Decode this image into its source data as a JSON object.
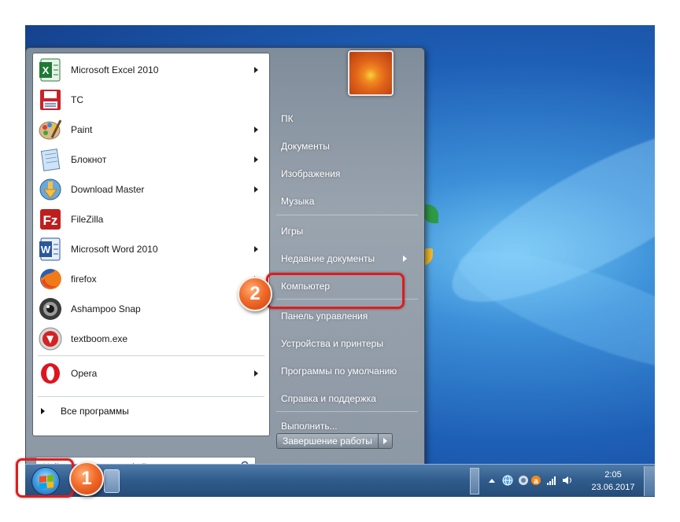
{
  "programs": [
    {
      "label": "Microsoft Excel 2010",
      "icon": "excel-icon",
      "submenu": true
    },
    {
      "label": "TC",
      "icon": "total-commander-icon",
      "submenu": false
    },
    {
      "label": "Paint",
      "icon": "paint-icon",
      "submenu": true
    },
    {
      "label": "Блокнот",
      "icon": "notepad-icon",
      "submenu": true
    },
    {
      "label": "Download Master",
      "icon": "download-master-icon",
      "submenu": true
    },
    {
      "label": "FileZilla",
      "icon": "filezilla-icon",
      "submenu": false
    },
    {
      "label": "Microsoft Word 2010",
      "icon": "word-icon",
      "submenu": true
    },
    {
      "label": "firefox",
      "icon": "firefox-icon",
      "submenu": true
    },
    {
      "label": "Ashampoo Snap",
      "icon": "ashampoo-snap-icon",
      "submenu": false
    },
    {
      "label": "textboom.exe",
      "icon": "textboom-icon",
      "submenu": false
    },
    {
      "label": "Opera",
      "icon": "opera-icon",
      "submenu": true
    }
  ],
  "all_programs": "Все программы",
  "search": {
    "placeholder": "Найти программы и файлы"
  },
  "right_items": [
    {
      "label": "ПК",
      "submenu": false
    },
    {
      "label": "Документы",
      "submenu": false
    },
    {
      "label": "Изображения",
      "submenu": false
    },
    {
      "label": "Музыка",
      "submenu": false
    },
    {
      "label": "Игры",
      "submenu": false
    },
    {
      "label": "Недавние документы",
      "submenu": true
    },
    {
      "label": "Компьютер",
      "submenu": false
    },
    {
      "label": "Панель управления",
      "submenu": false
    },
    {
      "label": "Устройства и принтеры",
      "submenu": false
    },
    {
      "label": "Программы по умолчанию",
      "submenu": false
    },
    {
      "label": "Справка и поддержка",
      "submenu": false
    },
    {
      "label": "Выполнить...",
      "submenu": false
    }
  ],
  "shutdown_label": "Завершение работы",
  "clock": {
    "time": "2:05",
    "date": "23.06.2017"
  },
  "callouts": [
    "1",
    "2"
  ],
  "colors": {
    "highlight": "#e31b1b",
    "badge": "#f26b2a",
    "taskbar": "#2f5b8c"
  }
}
